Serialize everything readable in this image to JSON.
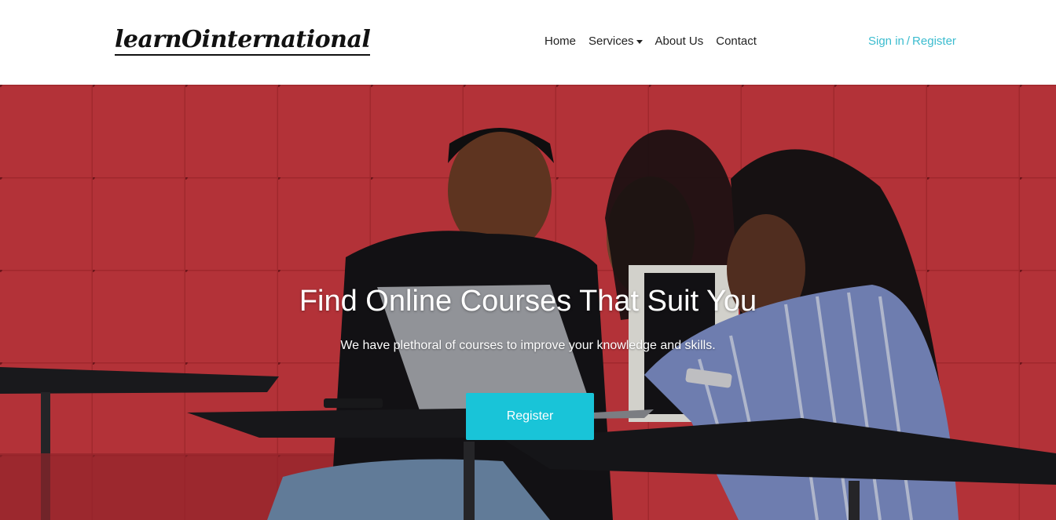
{
  "brand": {
    "logo_text": "learnOinternational"
  },
  "nav": {
    "items": [
      {
        "label": "Home"
      },
      {
        "label": "Services",
        "has_dropdown": true
      },
      {
        "label": "About Us"
      },
      {
        "label": "Contact"
      }
    ]
  },
  "auth": {
    "sign_in": "Sign in",
    "separator": "/",
    "register": "Register"
  },
  "hero": {
    "title": "Find Online Courses That Suit You",
    "subtitle": "We have plethoral of courses to improve your knowledge and skills.",
    "cta_label": "Register",
    "image": "three-students-with-laptop-photo"
  },
  "colors": {
    "accent": "#19c4d8",
    "link": "#3bbccf",
    "hero_bg": "#c9343b"
  }
}
